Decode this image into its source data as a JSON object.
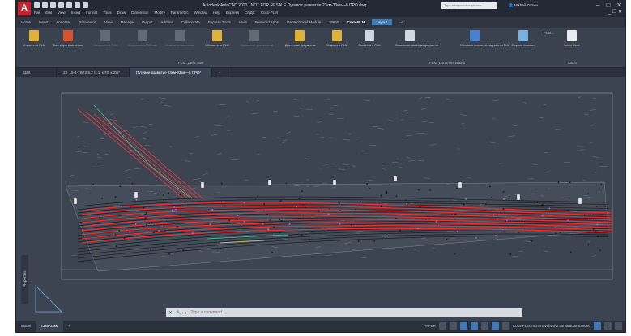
{
  "app": {
    "logo": "A",
    "title": "Autodesk AutoCAD 2020 - NOT FOR RESALE   Путевое развитие 23км-33км—6 ПРО.dwg",
    "menu": [
      "File",
      "Edit",
      "View",
      "Insert",
      "Format",
      "Tools",
      "Draw",
      "Dimension",
      "Modify",
      "Parametric",
      "Window",
      "Help",
      "Express",
      "СПДС",
      "Coxx-PLM"
    ],
    "search_placeholder": "Type a keyword or phrase",
    "user": "Mikhail.Zotnov",
    "window_controls": [
      "–",
      "□",
      "✕"
    ],
    "doc_controls": "_ ☐ ✕"
  },
  "ribbon": {
    "tabs": [
      "Home",
      "Insert",
      "Annotate",
      "Parametric",
      "View",
      "Manage",
      "Output",
      "Add-ins",
      "Collaborate",
      "Express Tools",
      "Vault",
      "Featured Apps",
      "Geotechnical Module",
      "SPDS",
      "Coxx-PLM",
      "Layout"
    ],
    "active_tab": "Layout",
    "buttons": [
      {
        "label": "Открыть из PLM",
        "color": "#e0b23a",
        "enabled": true
      },
      {
        "label": "Взять для изменения",
        "color": "#d8532d",
        "enabled": true
      },
      {
        "label": "Сохранить в PLM",
        "color": "#8a919c",
        "enabled": false
      },
      {
        "label": "Сохранить в PLM как",
        "color": "#8a919c",
        "enabled": false
      },
      {
        "label": "Отменить изменения",
        "color": "#8a919c",
        "enabled": false
      },
      {
        "label": "Обновить из PLM",
        "color": "#e0b23a",
        "enabled": true
      },
      {
        "label": "Управление документом",
        "color": "#8a919c",
        "enabled": false
      },
      {
        "label": "Доступные документы",
        "color": "#e0b23a",
        "enabled": true
      },
      {
        "label": "Открыть в PLM",
        "color": "#e0b23a",
        "enabled": true
      },
      {
        "label": "Свойства в PLM",
        "color": "#cfd8e2",
        "enabled": true
      },
      {
        "label": "Локальные свойства документа",
        "color": "#cfd8e2",
        "enabled": true
      },
      {
        "label": "Обновить основную надпись из PLM",
        "color": "#4a7fd0",
        "enabled": true
      },
      {
        "label": "Создать планшет",
        "color": "#7ab0de",
        "enabled": true
      },
      {
        "label": "Select Mode",
        "color": "#e8eaee",
        "enabled": true
      }
    ],
    "groups": [
      "PLM: Действия",
      "PLM: Дополнительно",
      "Touch"
    ],
    "plm_badge": "PLM..."
  },
  "doc_tabs": [
    "Start",
    "23_15-4-ТКР.2.5.2 (к.1, к.70, к.25)*",
    "Путевое развитие 23км-33км—6 ПРО*",
    "+"
  ],
  "active_doc_tab": 2,
  "canvas": {
    "side_panel_label": "Properties",
    "command_placeholder": "Type a command"
  },
  "status": {
    "layout_tabs": [
      "Model",
      "23км-33км",
      "+"
    ],
    "active_layout": 1,
    "paper_label": "PAPER",
    "user": "Coxx-PLM: m.zotnov@vm-2.constructor.ru:8080"
  },
  "colors": {
    "accent": "#3f78b5",
    "drawing_bg": "#3c4451",
    "red_lines": "#ff2a2a"
  }
}
